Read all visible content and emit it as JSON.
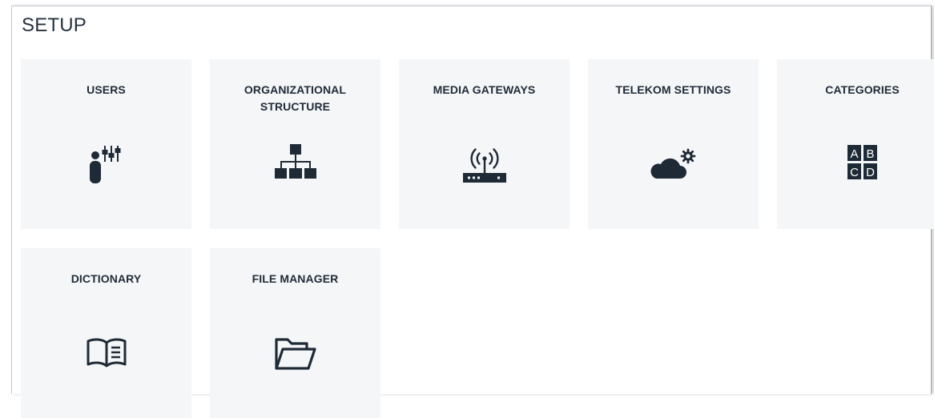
{
  "page": {
    "title": "SETUP"
  },
  "tiles": [
    {
      "label": "USERS",
      "icon": "user-settings-icon"
    },
    {
      "label": "ORGANIZATIONAL STRUCTURE",
      "icon": "org-chart-icon"
    },
    {
      "label": "MEDIA GATEWAYS",
      "icon": "router-icon"
    },
    {
      "label": "TELEKOM SETTINGS",
      "icon": "cloud-gear-icon"
    },
    {
      "label": "CATEGORIES",
      "icon": "abcd-icon"
    },
    {
      "label": "DICTIONARY",
      "icon": "open-book-icon"
    },
    {
      "label": "FILE MANAGER",
      "icon": "open-folder-icon"
    }
  ],
  "categories_icon": {
    "letters": [
      "A",
      "B",
      "C",
      "D"
    ]
  },
  "colors": {
    "tile_background": "#f5f6f8",
    "text": "#1f2b38",
    "icon": "#1f2a37"
  }
}
